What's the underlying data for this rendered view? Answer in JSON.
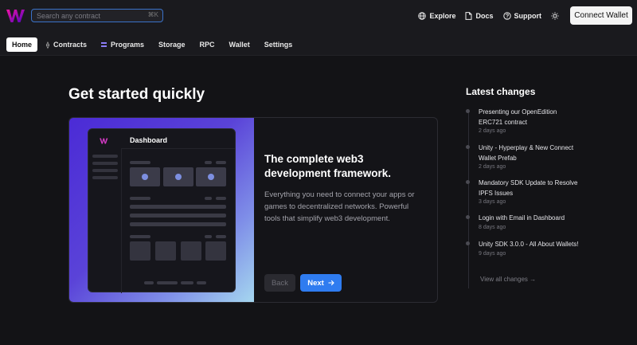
{
  "header": {
    "search_placeholder": "Search any contract",
    "search_shortcut": "⌘K",
    "links": [
      {
        "label": "Explore",
        "icon": "globe-icon"
      },
      {
        "label": "Docs",
        "icon": "document-icon"
      },
      {
        "label": "Support",
        "icon": "help-circle-icon"
      }
    ],
    "theme_icon": "sun-icon",
    "connect_label": "Connect Wallet"
  },
  "tabs": [
    {
      "label": "Home",
      "active": true
    },
    {
      "label": "Contracts",
      "icon": "ethereum-icon"
    },
    {
      "label": "Programs",
      "icon": "solana-icon"
    },
    {
      "label": "Storage"
    },
    {
      "label": "RPC"
    },
    {
      "label": "Wallet"
    },
    {
      "label": "Settings"
    }
  ],
  "main": {
    "heading": "Get started quickly",
    "card": {
      "mock_title": "Dashboard",
      "title": "The complete web3 development framework.",
      "description": "Everything you need to connect your apps or games to decentralized networks. Powerful tools that simplify web3 development.",
      "back_label": "Back",
      "next_label": "Next"
    }
  },
  "sidebar": {
    "heading": "Latest changes",
    "items": [
      {
        "title": "Presenting our OpenEdition ERC721 contract",
        "date": "2 days ago"
      },
      {
        "title": "Unity - Hyperplay & New Connect Wallet Prefab",
        "date": "2 days ago"
      },
      {
        "title": "Mandatory SDK Update to Resolve IPFS Issues",
        "date": "3 days ago"
      },
      {
        "title": "Login with Email in Dashboard",
        "date": "8 days ago"
      },
      {
        "title": "Unity SDK 3.0.0 - All About Wallets!",
        "date": "9 days ago"
      }
    ],
    "view_all": "View all changes →"
  },
  "colors": {
    "accent_blue": "#2f7cf0",
    "brand_purple": "#c026d3",
    "background": "#131316"
  }
}
